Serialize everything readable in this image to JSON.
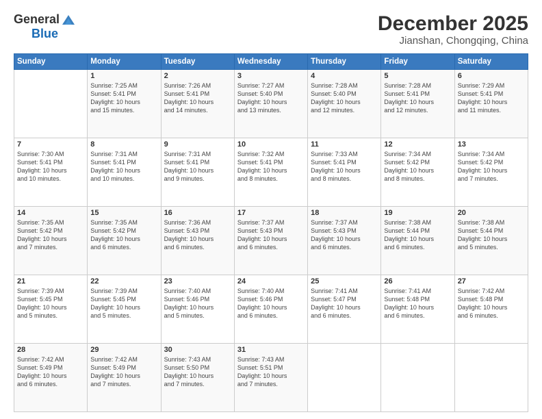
{
  "header": {
    "logo_line1": "General",
    "logo_line2": "Blue",
    "title": "December 2025",
    "subtitle": "Jianshan, Chongqing, China"
  },
  "days_of_week": [
    "Sunday",
    "Monday",
    "Tuesday",
    "Wednesday",
    "Thursday",
    "Friday",
    "Saturday"
  ],
  "weeks": [
    [
      {
        "day": "",
        "info": ""
      },
      {
        "day": "1",
        "info": "Sunrise: 7:25 AM\nSunset: 5:41 PM\nDaylight: 10 hours\nand 15 minutes."
      },
      {
        "day": "2",
        "info": "Sunrise: 7:26 AM\nSunset: 5:41 PM\nDaylight: 10 hours\nand 14 minutes."
      },
      {
        "day": "3",
        "info": "Sunrise: 7:27 AM\nSunset: 5:40 PM\nDaylight: 10 hours\nand 13 minutes."
      },
      {
        "day": "4",
        "info": "Sunrise: 7:28 AM\nSunset: 5:40 PM\nDaylight: 10 hours\nand 12 minutes."
      },
      {
        "day": "5",
        "info": "Sunrise: 7:28 AM\nSunset: 5:41 PM\nDaylight: 10 hours\nand 12 minutes."
      },
      {
        "day": "6",
        "info": "Sunrise: 7:29 AM\nSunset: 5:41 PM\nDaylight: 10 hours\nand 11 minutes."
      }
    ],
    [
      {
        "day": "7",
        "info": "Sunrise: 7:30 AM\nSunset: 5:41 PM\nDaylight: 10 hours\nand 10 minutes."
      },
      {
        "day": "8",
        "info": "Sunrise: 7:31 AM\nSunset: 5:41 PM\nDaylight: 10 hours\nand 10 minutes."
      },
      {
        "day": "9",
        "info": "Sunrise: 7:31 AM\nSunset: 5:41 PM\nDaylight: 10 hours\nand 9 minutes."
      },
      {
        "day": "10",
        "info": "Sunrise: 7:32 AM\nSunset: 5:41 PM\nDaylight: 10 hours\nand 8 minutes."
      },
      {
        "day": "11",
        "info": "Sunrise: 7:33 AM\nSunset: 5:41 PM\nDaylight: 10 hours\nand 8 minutes."
      },
      {
        "day": "12",
        "info": "Sunrise: 7:34 AM\nSunset: 5:42 PM\nDaylight: 10 hours\nand 8 minutes."
      },
      {
        "day": "13",
        "info": "Sunrise: 7:34 AM\nSunset: 5:42 PM\nDaylight: 10 hours\nand 7 minutes."
      }
    ],
    [
      {
        "day": "14",
        "info": "Sunrise: 7:35 AM\nSunset: 5:42 PM\nDaylight: 10 hours\nand 7 minutes."
      },
      {
        "day": "15",
        "info": "Sunrise: 7:35 AM\nSunset: 5:42 PM\nDaylight: 10 hours\nand 6 minutes."
      },
      {
        "day": "16",
        "info": "Sunrise: 7:36 AM\nSunset: 5:43 PM\nDaylight: 10 hours\nand 6 minutes."
      },
      {
        "day": "17",
        "info": "Sunrise: 7:37 AM\nSunset: 5:43 PM\nDaylight: 10 hours\nand 6 minutes."
      },
      {
        "day": "18",
        "info": "Sunrise: 7:37 AM\nSunset: 5:43 PM\nDaylight: 10 hours\nand 6 minutes."
      },
      {
        "day": "19",
        "info": "Sunrise: 7:38 AM\nSunset: 5:44 PM\nDaylight: 10 hours\nand 6 minutes."
      },
      {
        "day": "20",
        "info": "Sunrise: 7:38 AM\nSunset: 5:44 PM\nDaylight: 10 hours\nand 5 minutes."
      }
    ],
    [
      {
        "day": "21",
        "info": "Sunrise: 7:39 AM\nSunset: 5:45 PM\nDaylight: 10 hours\nand 5 minutes."
      },
      {
        "day": "22",
        "info": "Sunrise: 7:39 AM\nSunset: 5:45 PM\nDaylight: 10 hours\nand 5 minutes."
      },
      {
        "day": "23",
        "info": "Sunrise: 7:40 AM\nSunset: 5:46 PM\nDaylight: 10 hours\nand 5 minutes."
      },
      {
        "day": "24",
        "info": "Sunrise: 7:40 AM\nSunset: 5:46 PM\nDaylight: 10 hours\nand 6 minutes."
      },
      {
        "day": "25",
        "info": "Sunrise: 7:41 AM\nSunset: 5:47 PM\nDaylight: 10 hours\nand 6 minutes."
      },
      {
        "day": "26",
        "info": "Sunrise: 7:41 AM\nSunset: 5:48 PM\nDaylight: 10 hours\nand 6 minutes."
      },
      {
        "day": "27",
        "info": "Sunrise: 7:42 AM\nSunset: 5:48 PM\nDaylight: 10 hours\nand 6 minutes."
      }
    ],
    [
      {
        "day": "28",
        "info": "Sunrise: 7:42 AM\nSunset: 5:49 PM\nDaylight: 10 hours\nand 6 minutes."
      },
      {
        "day": "29",
        "info": "Sunrise: 7:42 AM\nSunset: 5:49 PM\nDaylight: 10 hours\nand 7 minutes."
      },
      {
        "day": "30",
        "info": "Sunrise: 7:43 AM\nSunset: 5:50 PM\nDaylight: 10 hours\nand 7 minutes."
      },
      {
        "day": "31",
        "info": "Sunrise: 7:43 AM\nSunset: 5:51 PM\nDaylight: 10 hours\nand 7 minutes."
      },
      {
        "day": "",
        "info": ""
      },
      {
        "day": "",
        "info": ""
      },
      {
        "day": "",
        "info": ""
      }
    ]
  ]
}
